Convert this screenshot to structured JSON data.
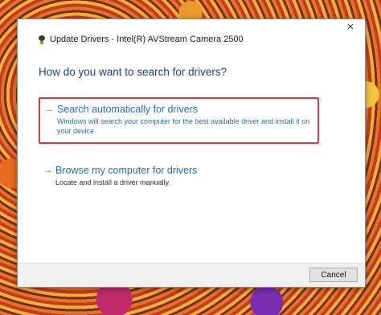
{
  "dialog": {
    "title": "Update Drivers - Intel(R) AVStream Camera 2500",
    "close_icon": "×",
    "question": "How do you want to search for drivers?",
    "options": [
      {
        "label": "Search automatically for drivers",
        "description": "Windows will search your computer for the best available driver and install it on your device.",
        "highlighted": true
      },
      {
        "label": "Browse my computer for drivers",
        "description": "Locate and install a driver manually.",
        "highlighted": false
      }
    ],
    "arrow_glyph": "→",
    "cancel_label": "Cancel"
  },
  "colors": {
    "link_blue": "#1a6fc4",
    "heading_blue": "#1f3b8a",
    "highlight_red": "#d93a3f"
  }
}
